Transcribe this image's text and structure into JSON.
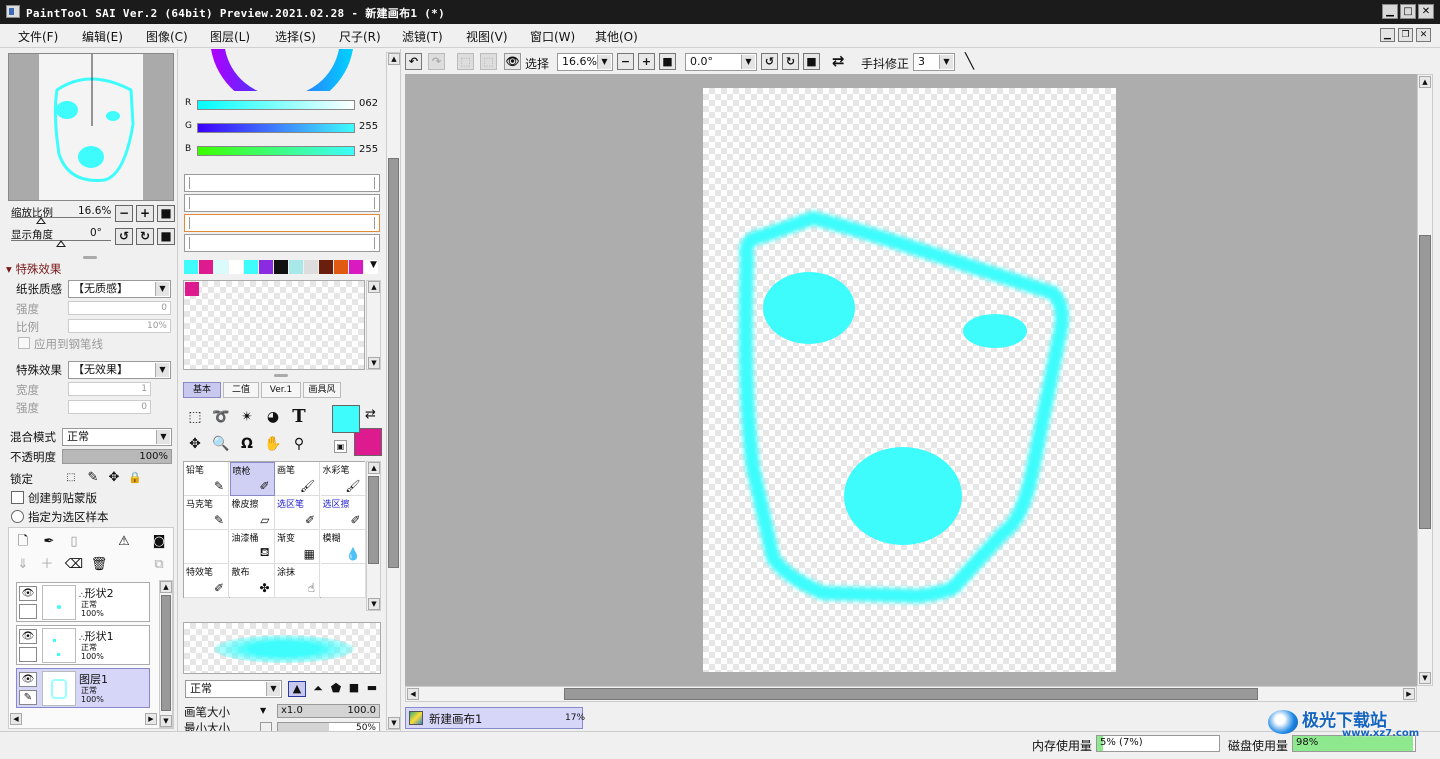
{
  "window": {
    "title": "PaintTool SAI Ver.2 (64bit) Preview.2021.02.28 - 新建画布1 (*)",
    "min": "▁",
    "max": "□",
    "close": "✕"
  },
  "menu": [
    "文件(F)",
    "编辑(E)",
    "图像(C)",
    "图层(L)",
    "选择(S)",
    "尺子(R)",
    "滤镜(T)",
    "视图(V)",
    "窗口(W)",
    "其他(O)"
  ],
  "navigator": {
    "zoom_label": "缩放比例",
    "zoom_value": "16.6%",
    "angle_label": "显示角度",
    "angle_value": "0°"
  },
  "effects": {
    "header": "特殊效果",
    "paper_label": "纸张质感",
    "paper_value": "【无质感】",
    "strength_label": "强度",
    "strength_value": "0",
    "scale_label": "比例",
    "scale_value": "10%",
    "apply_pen": "应用到钢笔线",
    "effect_label": "特殊效果",
    "effect_value": "【无效果】",
    "width_label": "宽度",
    "width_value": "1",
    "strength2_label": "强度",
    "strength2_value": "0"
  },
  "layer_props": {
    "blend_label": "混合模式",
    "blend_value": "正常",
    "opacity_label": "不透明度",
    "opacity_value": "100%",
    "opacity_fraction": 1.0,
    "lock_label": "锁定",
    "clip_label": "创建剪贴蒙版",
    "sample_label": "指定为选区样本"
  },
  "layers": [
    {
      "name": "形状2",
      "mode": "正常",
      "opacity": "100%"
    },
    {
      "name": "形状1",
      "mode": "正常",
      "opacity": "100%"
    },
    {
      "name": "图层1",
      "mode": "正常",
      "opacity": "100%"
    }
  ],
  "color": {
    "r_label": "R",
    "r_value": "062",
    "r": 62,
    "g_label": "G",
    "g_value": "255",
    "g": 255,
    "b_label": "B",
    "b_value": "255",
    "b": 255,
    "swatches": [
      "#3efcfc",
      "#dd1a8e",
      "#d9fbfb",
      "#ffffff",
      "#3efcfc",
      "#8a2be2",
      "#111111",
      "#a8e8e8",
      "#dddddd",
      "#6a1e0e",
      "#e05a12",
      "#d91ac0",
      "#ffffff"
    ],
    "primary": "#3efcfc",
    "secondary": "#dd1a8e",
    "scratch_first": "#dd1a8e"
  },
  "tool_tabs": [
    "基本",
    "二值",
    "Ver.1",
    "画具风"
  ],
  "brushes": [
    {
      "label": "铅笔",
      "icon": "✎",
      "blue": false,
      "sel": false
    },
    {
      "label": "喷枪",
      "icon": "✐",
      "blue": false,
      "sel": true
    },
    {
      "label": "画笔",
      "icon": "🖌",
      "blue": false,
      "sel": false
    },
    {
      "label": "水彩笔",
      "icon": "🖌",
      "blue": false,
      "sel": false
    },
    {
      "label": "马克笔",
      "icon": "✎",
      "blue": false,
      "sel": false
    },
    {
      "label": "橡皮擦",
      "icon": "▱",
      "blue": false,
      "sel": false
    },
    {
      "label": "选区笔",
      "icon": "✐",
      "blue": true,
      "sel": false
    },
    {
      "label": "选区擦",
      "icon": "✐",
      "blue": true,
      "sel": false
    },
    {
      "label": "",
      "icon": "",
      "blue": false,
      "sel": false
    },
    {
      "label": "油漆桶",
      "icon": "⛾",
      "blue": false,
      "sel": false
    },
    {
      "label": "渐变",
      "icon": "▦",
      "blue": false,
      "sel": false
    },
    {
      "label": "模糊",
      "icon": "💧",
      "blue": false,
      "sel": false
    },
    {
      "label": "特效笔",
      "icon": "✐",
      "blue": false,
      "sel": false
    },
    {
      "label": "散布",
      "icon": "✤",
      "blue": false,
      "sel": false
    },
    {
      "label": "涂抹",
      "icon": "☝",
      "blue": false,
      "sel": false
    },
    {
      "label": "",
      "icon": "",
      "blue": false,
      "sel": false
    }
  ],
  "brush_settings": {
    "mode_value": "正常",
    "size_label": "画笔大小",
    "size_mult": "x1.0",
    "size_value": "100.0",
    "min_label": "最小大小",
    "min_value": "50%"
  },
  "toolbar": {
    "select_label": "选择",
    "zoom_value": "16.6%",
    "angle_value": "0.0°",
    "stabilizer_label": "手抖修正",
    "stabilizer_value": "3"
  },
  "canvas_tabs": [
    {
      "name": "新建画布1",
      "percent": "17%"
    }
  ],
  "status": {
    "mem_label": "内存使用量",
    "mem_value": "5% (7%)",
    "mem_fraction": 0.05,
    "disk_label": "磁盘使用量",
    "disk_value": "98%",
    "disk_fraction": 0.98
  },
  "watermark": "极光下载站 www.xz7.com"
}
